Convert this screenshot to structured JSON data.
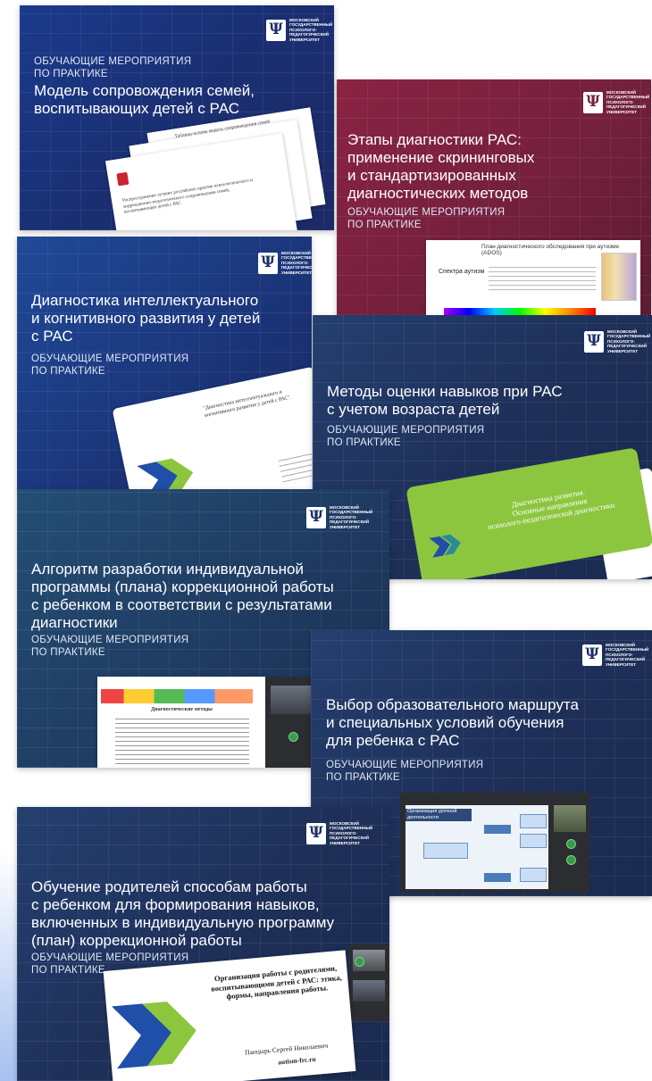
{
  "logo": {
    "mark": "Ψ",
    "text": "МОСКОВСКИЙ\nГОСУДАРСТВЕННЫЙ\nПСИХОЛОГО-\nПЕДАГОГИЧЕСКИЙ\nУНИВЕРСИТЕТ"
  },
  "subtitle": {
    "line1": "ОБУЧАЮЩИЕ МЕРОПРИЯТИЯ",
    "line2": "ПО ПРАКТИКЕ"
  },
  "cards": [
    {
      "title_line1": "Модель сопровождения семей,",
      "title_line2": "воспитывающих детей с РАС"
    },
    {
      "title_line1": "Этапы диагностики РАС:",
      "title_line2": "применение скрининговых",
      "title_line3": "и стандартизированных",
      "title_line4": "диагностических методов"
    },
    {
      "title_line1": "Диагностика интеллектуального",
      "title_line2": "и когнитивного развития у детей",
      "title_line3": "с РАС"
    },
    {
      "title_line1": "Методы оценки навыков при РАС",
      "title_line2": "с учетом возраста детей"
    },
    {
      "title_line1": "Алгоритм разработки индивидуальной",
      "title_line2": "программы (плана) коррекционной работы",
      "title_line3": "с ребенком в соответствии с результатами",
      "title_line4": "диагностики"
    },
    {
      "title_line1": "Выбор образовательного маршрута",
      "title_line2": "и специальных условий обучения",
      "title_line3": "для ребенка с РАС"
    },
    {
      "title_line1": "Обучение родителей способам работы",
      "title_line2": "с ребенком для формирования навыков,",
      "title_line3": "включенных в индивидуальную программу",
      "title_line4": "(план) коррекционной работы"
    }
  ],
  "slides": {
    "s1_header": "Таблица-основа модель сопровождения семей",
    "s1_body": "Распространение лучших российских практик психологического и коррекционно-педагогического сопровождения семей, воспитывающих детей с РАС",
    "s2_header": "План диагностического обследования при аутизме (ADOS)",
    "s2_label": "Спектра аутизм",
    "s3_quote": "\"Диагностика интеллектуального и когнитивного развития у детей с РАС\".",
    "s4_line1": "Диагностика развития.",
    "s4_line2": "Основные направления",
    "s4_line3": "психолого-педагогической  диагностики",
    "s5_title": "Диагностические методы",
    "s6_box1": "Организация урочной деятельности",
    "s7_line1": "Организация работы с родителями,",
    "s7_line2": "воспитывающими детей с РАС: этика,",
    "s7_line3": "формы, направления работы.",
    "s7_author": "Панцырь Сергей Николаевич",
    "s7_site": "autism-frc.ru"
  },
  "colors": {
    "blue": "#1b3a8c",
    "maroon": "#74203c",
    "navy": "#1e2f58",
    "lime": "#8cc63f",
    "accent_green": "#3a9b4a"
  }
}
